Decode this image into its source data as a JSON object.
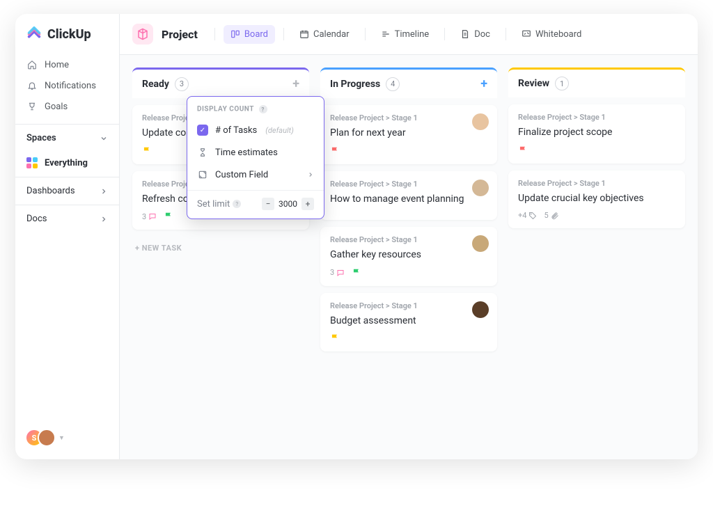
{
  "brand": "ClickUp",
  "sidebar": {
    "nav": [
      {
        "label": "Home"
      },
      {
        "label": "Notifications"
      },
      {
        "label": "Goals"
      }
    ],
    "spaces_label": "Spaces",
    "everything_label": "Everything",
    "rows": [
      {
        "label": "Dashboards"
      },
      {
        "label": "Docs"
      }
    ],
    "user_initial": "S"
  },
  "topbar": {
    "title": "Project",
    "tabs": [
      {
        "label": "Board",
        "active": true
      },
      {
        "label": "Calendar"
      },
      {
        "label": "Timeline"
      },
      {
        "label": "Doc"
      },
      {
        "label": "Whiteboard"
      }
    ]
  },
  "popover": {
    "header": "DISPLAY COUNT",
    "items": [
      {
        "label": "# of Tasks",
        "default_suffix": "(default)",
        "checked": true
      },
      {
        "label": "Time estimates"
      },
      {
        "label": "Custom Field",
        "has_submenu": true
      }
    ],
    "limit_label": "Set limit",
    "limit_value": "3000"
  },
  "columns": [
    {
      "title": "Ready",
      "count": "3",
      "accent": "purple",
      "cards": [
        {
          "crumb": "Release Project > Stage 1",
          "title": "Update contractor agreement",
          "flag": "yellow"
        },
        {
          "crumb": "Release Project > Stage 1",
          "title": "Refresh company website",
          "comments": "3",
          "flag": "green",
          "avatar": "cav2"
        }
      ],
      "new_task": "+ NEW TASK"
    },
    {
      "title": "In Progress",
      "count": "4",
      "accent": "blue",
      "add_blue": true,
      "cards": [
        {
          "crumb": "Release Project > Stage 1",
          "title": "Plan for next year",
          "flag": "red",
          "avatar": "cav1"
        },
        {
          "crumb": "Release Project > Stage 1",
          "title": "How to manage event planning",
          "avatar": "cav3"
        },
        {
          "crumb": "Release Project > Stage 1",
          "title": "Gather key resources",
          "comments": "3",
          "flag": "green",
          "avatar": "cav4"
        },
        {
          "crumb": "Release Project > Stage 1",
          "title": "Budget assessment",
          "flag": "yellow",
          "avatar": "cav5"
        }
      ]
    },
    {
      "title": "Review",
      "count": "1",
      "accent": "yellow",
      "cards": [
        {
          "crumb": "Release Project > Stage 1",
          "title": "Finalize project scope",
          "flag": "red"
        },
        {
          "crumb": "Release Project > Stage 1",
          "title": "Update crucial key objectives",
          "tags": "+4",
          "attachments": "5"
        }
      ]
    }
  ]
}
